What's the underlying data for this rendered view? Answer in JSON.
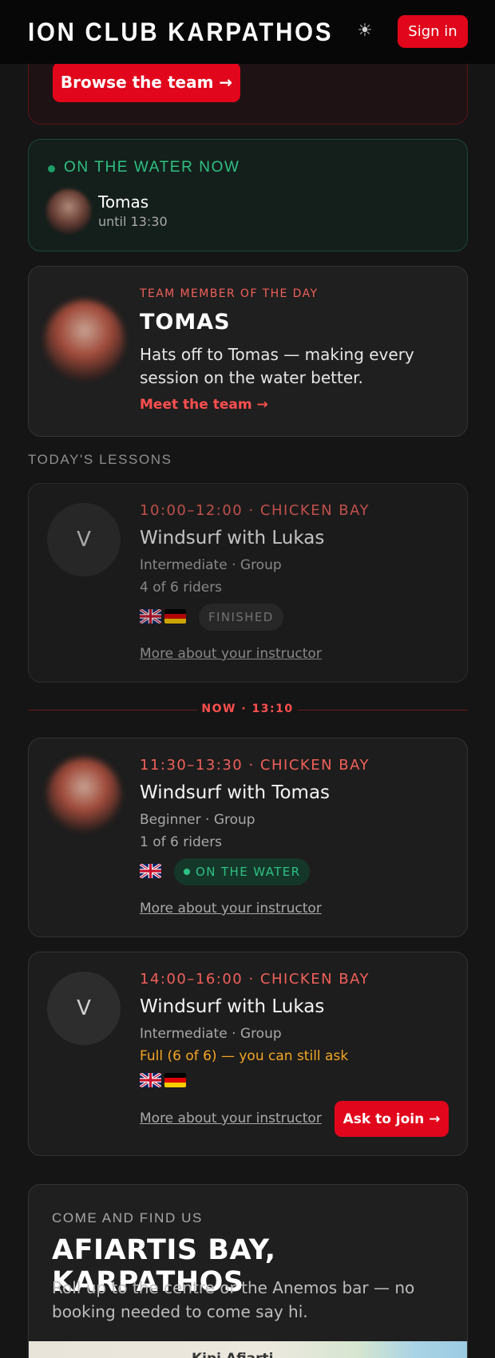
{
  "header": {
    "brand": "ION CLUB KARPATHOS",
    "theme_icon": "sun-icon",
    "signin_label": "Sign in"
  },
  "hero": {
    "browse_label": "Browse the team →"
  },
  "on_water": {
    "title": "ON THE WATER NOW",
    "name": "Tomas",
    "until": "until 13:30"
  },
  "team_member": {
    "kicker": "TEAM MEMBER OF THE DAY",
    "name": "TOMAS",
    "description": "Hats off to Tomas — making every session on the water better.",
    "link": "Meet the team →"
  },
  "lessons_label": "TODAY'S LESSONS",
  "now_divider": "NOW · 13:10",
  "lessons": [
    {
      "avatar_letter": "V",
      "time": "10:00–12:00 · CHICKEN BAY",
      "title": "Windsurf with Lukas",
      "level": "Intermediate · Group",
      "riders": "4 of 6 riders",
      "flags": [
        "uk-flag",
        "de-flag"
      ],
      "status": "FINISHED",
      "more": "More about your instructor"
    },
    {
      "avatar_letter": "",
      "time": "11:30–13:30 · CHICKEN BAY",
      "title": "Windsurf with Tomas",
      "level": "Beginner · Group",
      "riders": "1 of 6 riders",
      "flags": [
        "uk-flag"
      ],
      "status": "ON THE WATER",
      "more": "More about your instructor"
    },
    {
      "avatar_letter": "V",
      "time": "14:00–16:00 · CHICKEN BAY",
      "title": "Windsurf with Lukas",
      "level": "Intermediate · Group",
      "riders": "Full (6 of 6) — you can still ask",
      "flags": [
        "uk-flag",
        "de-flag"
      ],
      "more": "More about your instructor",
      "ask": "Ask to join →"
    }
  ],
  "find_us": {
    "kicker": "COME AND FIND US",
    "title": "AFIARTIS BAY, KARPATHOS",
    "description": "Roll up to the centre or the Anemos bar — no booking needed to come say hi.",
    "map_label": "Kipi Afiarti"
  },
  "colors": {
    "accent": "#e1061b",
    "accent_text": "#f0605a",
    "water_green": "#2ec184",
    "full_orange": "#f5a623",
    "background": "#151515"
  }
}
